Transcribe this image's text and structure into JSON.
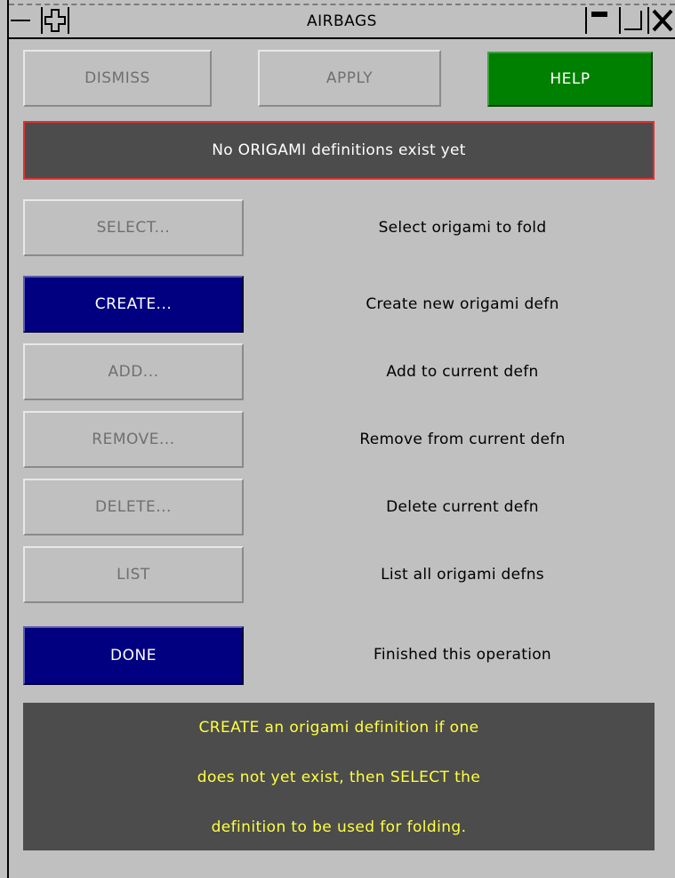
{
  "window": {
    "title": "AIRBAGS"
  },
  "toolbar": {
    "dismiss_label": "DISMISS",
    "apply_label": "APPLY",
    "help_label": "HELP"
  },
  "status_message": "No ORIGAMI definitions exist yet",
  "actions": [
    {
      "label": "SELECT...",
      "description": "Select origami to fold",
      "state": "disabled"
    },
    {
      "label": "CREATE...",
      "description": "Create new origami defn",
      "state": "active"
    },
    {
      "label": "ADD...",
      "description": "Add to current defn",
      "state": "disabled"
    },
    {
      "label": "REMOVE...",
      "description": "Remove from current defn",
      "state": "disabled"
    },
    {
      "label": "DELETE...",
      "description": "Delete current defn",
      "state": "disabled"
    },
    {
      "label": "LIST",
      "description": "List all origami defns",
      "state": "disabled"
    },
    {
      "label": "DONE",
      "description": "Finished this operation",
      "state": "active"
    }
  ],
  "help_text": [
    "CREATE an origami definition if one",
    "does not yet exist, then SELECT the",
    "definition to be used for folding."
  ],
  "colors": {
    "background": "#c0c0c0",
    "active_button": "#000080",
    "help_button": "#008000",
    "status_border": "#e03030",
    "panel_dark": "#4c4c4c",
    "help_text": "#ffff40"
  },
  "icons": {
    "title_left": "dash-icon",
    "move": "move-cross-icon",
    "minimize": "minimize-icon",
    "maximize": "maximize-icon",
    "close": "close-icon"
  }
}
